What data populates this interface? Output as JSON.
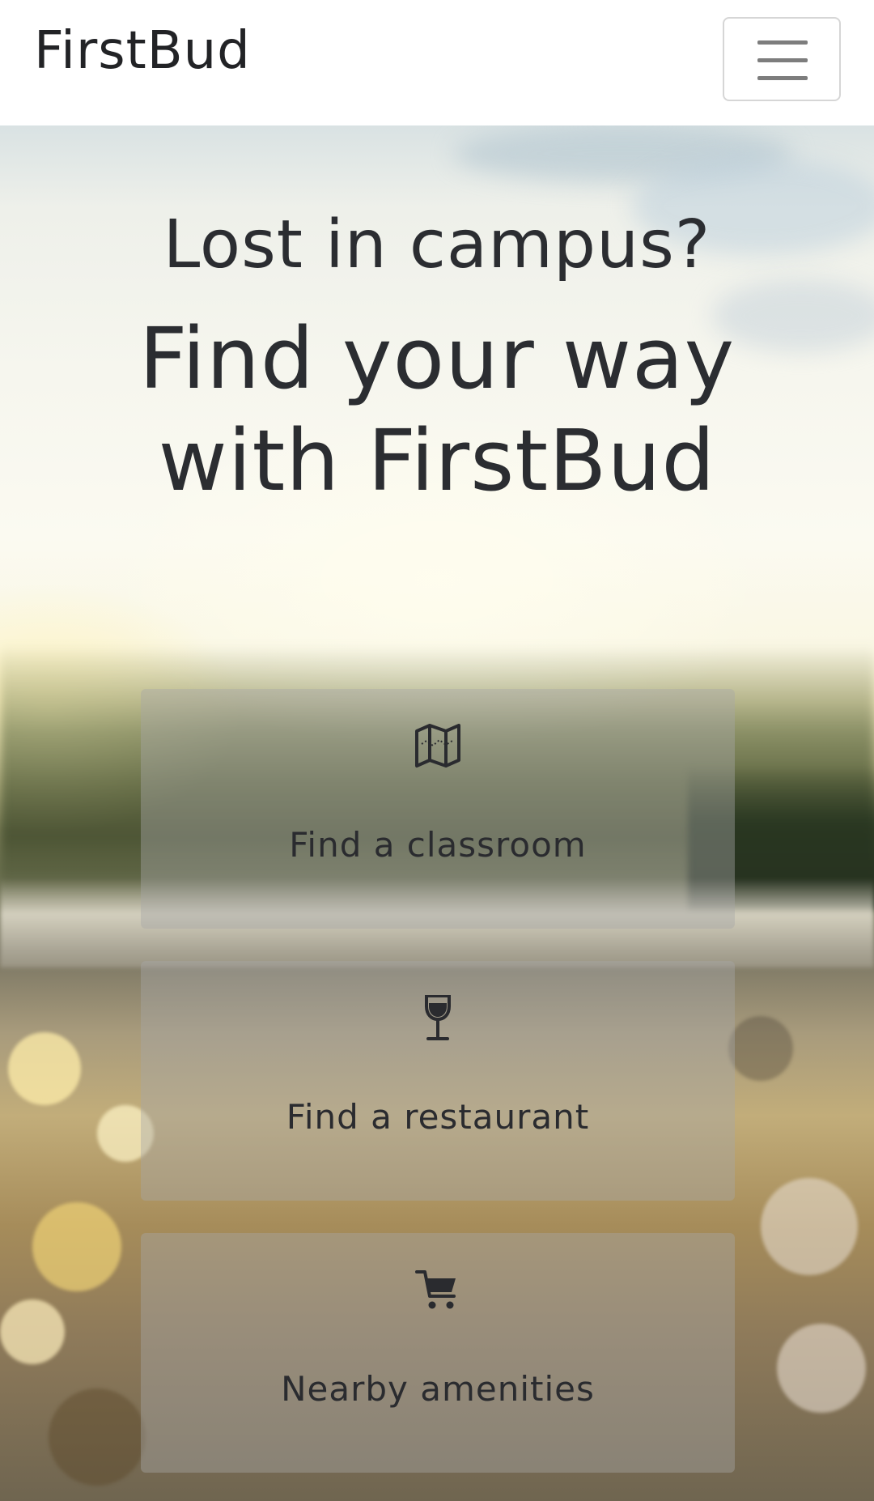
{
  "navbar": {
    "brand": "FirstBud",
    "menu_toggle_icon": "hamburger-menu-icon"
  },
  "hero": {
    "subtitle": "Lost in campus?",
    "title_line1": "Find your way",
    "title_line2": "with FirstBud"
  },
  "cards": [
    {
      "icon": "map-icon",
      "label": "Find a classroom"
    },
    {
      "icon": "wine-glass-icon",
      "label": "Find a restaurant"
    },
    {
      "icon": "shopping-cart-icon",
      "label": "Nearby amenities"
    }
  ],
  "colors": {
    "text": "#2b2d31",
    "navbar_background": "#ffffff",
    "card_overlay": "rgba(168,168,168,0.42)"
  }
}
